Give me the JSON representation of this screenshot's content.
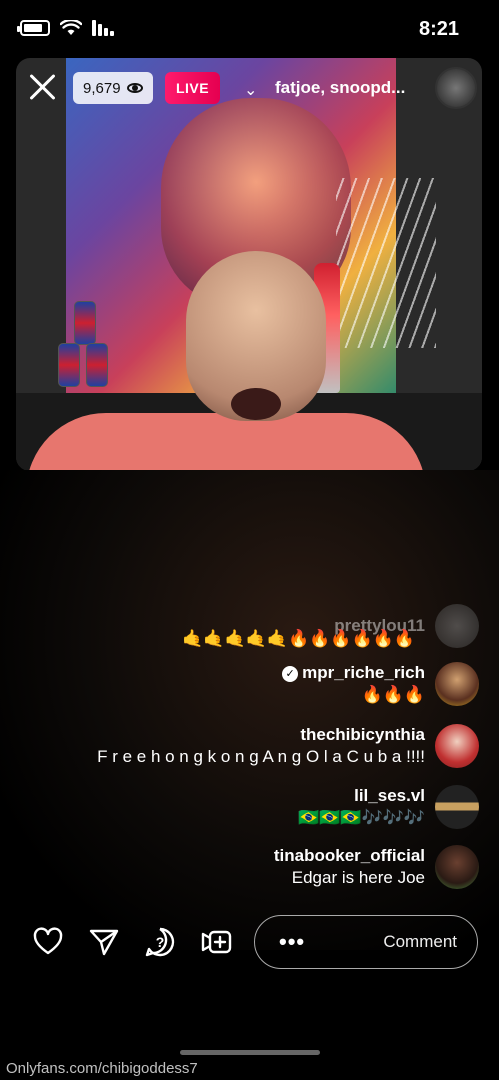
{
  "status_bar": {
    "time": "8:21",
    "icons": [
      "battery-icon",
      "wifi-icon",
      "signal-icon"
    ]
  },
  "header": {
    "host_name": "fatjoe, snoopd...",
    "live_label": "LIVE",
    "viewer_count": "9,679",
    "live_color": "#ff1a6c"
  },
  "comments": [
    {
      "user": "prettylou11",
      "message": "",
      "faded": true
    },
    {
      "user": "",
      "message": "🤙🤙🤙🤙🤙🔥🔥🔥🔥🔥🔥"
    },
    {
      "user": "mpr_riche_rich",
      "message": "🔥🔥🔥",
      "verified": true
    },
    {
      "user": "thechibicynthia",
      "message": "F r e e h o n g k o n g A n g O l a C u b a !!!!"
    },
    {
      "user": "lil_ses.vl",
      "message": "🇧🇷🇧🇷🇧🇷🎶🎶🎶"
    },
    {
      "user": "tinabooker_official",
      "message": "Edgar is here Joe"
    }
  ],
  "comment_input": {
    "placeholder": "Comment",
    "more_label": "•••"
  },
  "actions": [
    "heart-icon",
    "send-icon",
    "question-icon",
    "add-video-icon"
  ],
  "watermark": "Onlyfans.com/chibigoddess7"
}
